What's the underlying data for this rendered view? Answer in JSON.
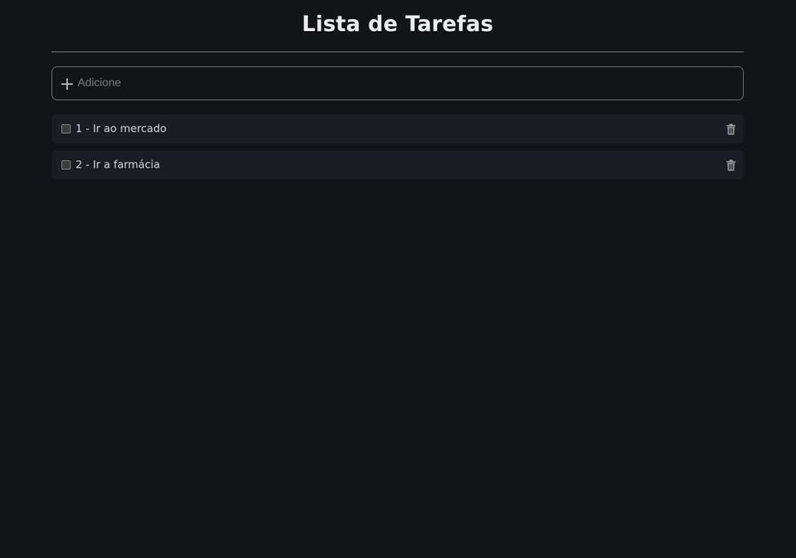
{
  "header": {
    "title": "Lista de Tarefas"
  },
  "add_task": {
    "placeholder": "Adicione",
    "value": "",
    "icon": "plus-icon"
  },
  "tasks": [
    {
      "label": "1 - Ir ao mercado",
      "checked": false,
      "delete_icon": "trash-icon"
    },
    {
      "label": "2 - Ir a farmácia",
      "checked": false,
      "delete_icon": "trash-icon"
    }
  ],
  "colors": {
    "background": "#131418",
    "task_background": "#1c1d24",
    "text": "#e6e6e6",
    "border": "#7a7a7a"
  }
}
